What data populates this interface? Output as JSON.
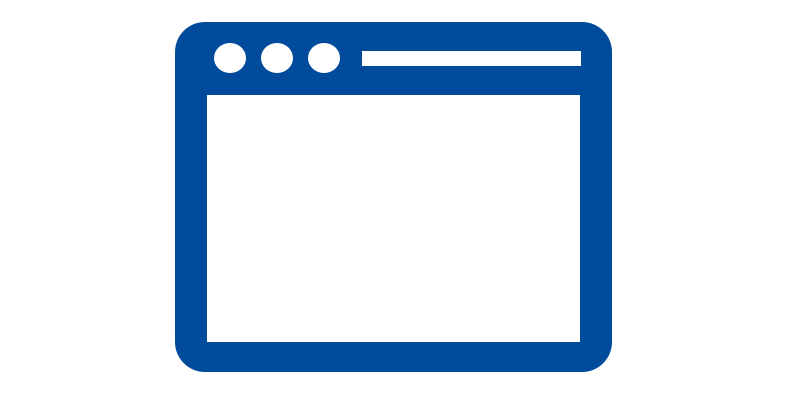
{
  "icon": {
    "name": "browser-window-icon",
    "color": "#004B9B",
    "background": "#FFFFFF",
    "window_dots": 3
  }
}
